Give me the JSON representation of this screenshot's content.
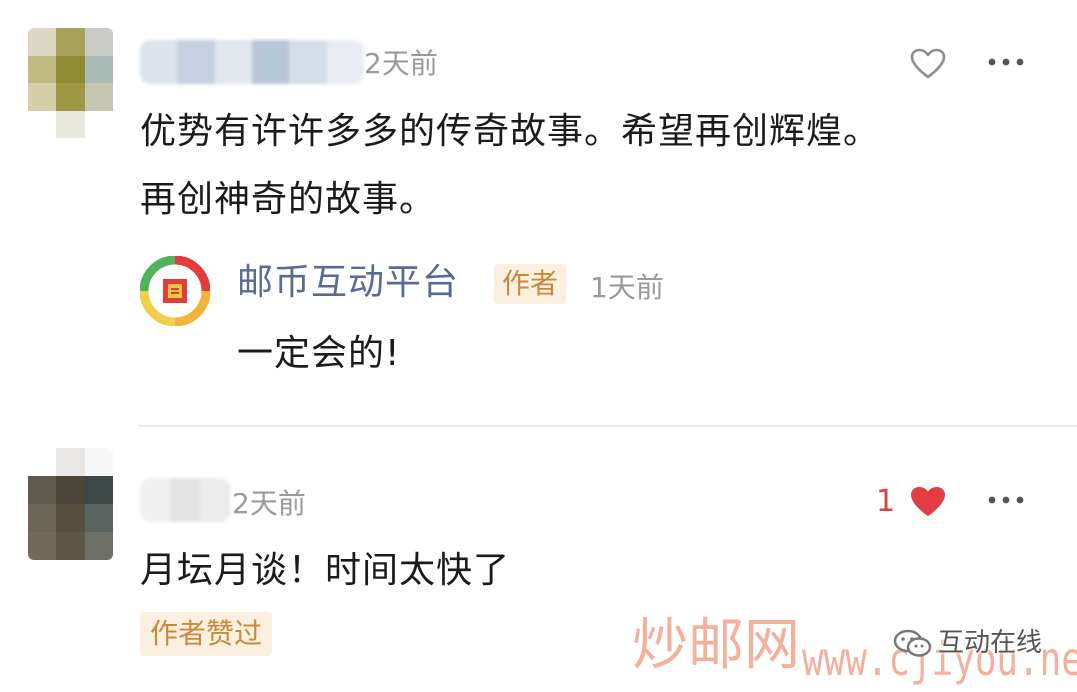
{
  "comments": [
    {
      "time": "2天前",
      "text_line1": "优势有许许多多的传奇故事。希望再创辉煌。",
      "text_line2": "再创神奇的故事。",
      "like_icon": "heart-outline-icon",
      "more_icon": "more-dots-icon",
      "reply": {
        "author": "邮币互动平台",
        "badge": "作者",
        "time": "1天前",
        "text": "一定会的!",
        "avatar_icon": "stamp-logo-icon"
      }
    },
    {
      "time": "2天前",
      "text": "月坛月谈！时间太快了",
      "like_count": "1",
      "like_icon": "heart-filled-icon",
      "more_icon": "more-dots-icon",
      "author_liked_badge": "作者赞过"
    }
  ],
  "watermark": {
    "site_cn": "炒邮网",
    "site_url": "www.cjiyou.net",
    "account_name": "互动在线"
  },
  "colors": {
    "link_blue": "#576b95",
    "badge_bg": "#fbf0df",
    "badge_text": "#c9893a",
    "like_red": "#e23d45",
    "muted_gray": "#9a9a9a",
    "watermark_pink": "#f4b09b"
  }
}
